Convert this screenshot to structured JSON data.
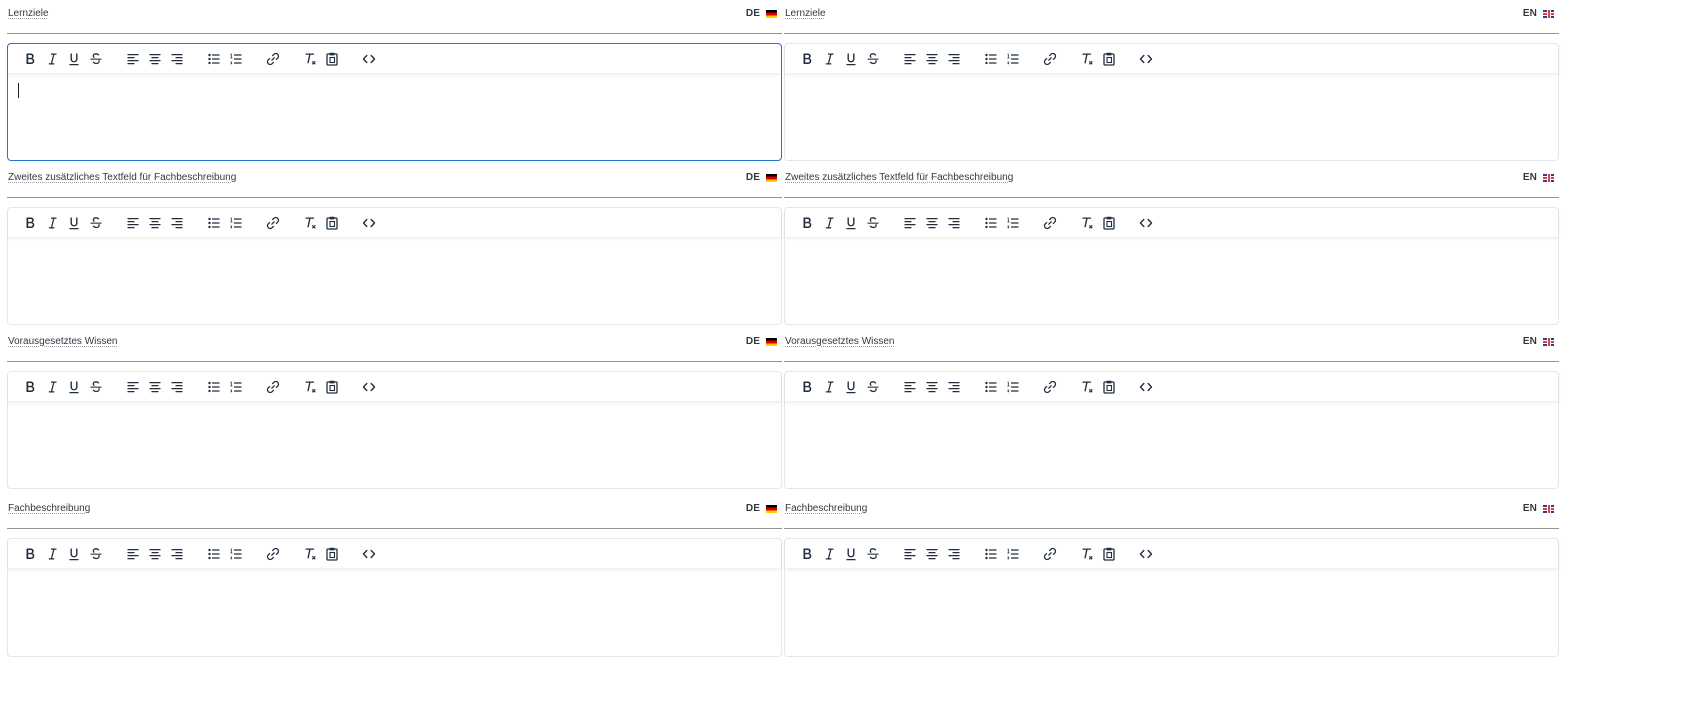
{
  "languages": {
    "de": {
      "code": "DE",
      "flag": "german-flag-icon"
    },
    "en": {
      "code": "EN",
      "flag": "uk-flag-icon"
    }
  },
  "fields": [
    {
      "id": "lernziele",
      "label": "Lernziele"
    },
    {
      "id": "zweites-textfeld",
      "label": "Zweites zusätzliches Textfeld für Fachbeschreibung"
    },
    {
      "id": "vorausgesetztes-wissen",
      "label": "Vorausgesetztes Wissen"
    },
    {
      "id": "fachbeschreibung",
      "label": "Fachbeschreibung"
    }
  ],
  "toolbar_buttons": [
    {
      "name": "bold",
      "icon": "bold-icon",
      "title": "Bold"
    },
    {
      "name": "italic",
      "icon": "italic-icon",
      "title": "Italic"
    },
    {
      "name": "underline",
      "icon": "underline-icon",
      "title": "Underline"
    },
    {
      "name": "strikethrough",
      "icon": "strikethrough-icon",
      "title": "Strikethrough"
    },
    {
      "name": "align-left",
      "icon": "align-left-icon",
      "title": "Align left"
    },
    {
      "name": "align-center",
      "icon": "align-center-icon",
      "title": "Align center"
    },
    {
      "name": "align-right",
      "icon": "align-right-icon",
      "title": "Align right"
    },
    {
      "name": "bullet-list",
      "icon": "bullet-list-icon",
      "title": "Bullet list"
    },
    {
      "name": "numbered-list",
      "icon": "numbered-list-icon",
      "title": "Numbered list"
    },
    {
      "name": "link",
      "icon": "link-icon",
      "title": "Insert/edit link"
    },
    {
      "name": "clear-formatting",
      "icon": "clear-formatting-icon",
      "title": "Clear formatting"
    },
    {
      "name": "paste",
      "icon": "paste-icon",
      "title": "Paste as text"
    },
    {
      "name": "source-code",
      "icon": "source-code-icon",
      "title": "Source code"
    }
  ],
  "focused_editor": "lernziele-de",
  "colors": {
    "focus_border": "#2276d2",
    "divider": "#8e949b",
    "editor_border": "#e4e6e9",
    "icon": "#222f3e"
  }
}
